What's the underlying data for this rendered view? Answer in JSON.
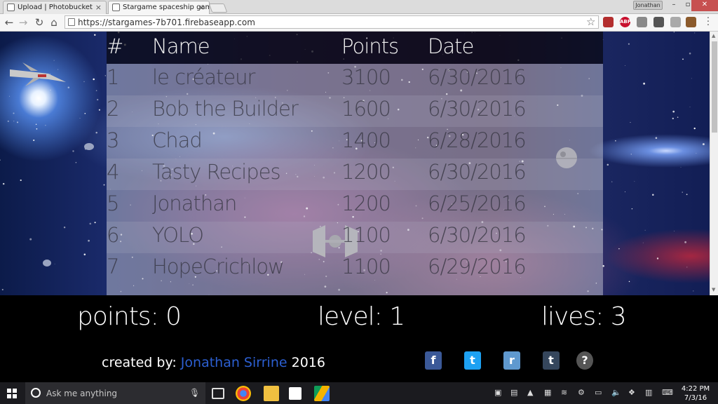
{
  "browser": {
    "tabs": [
      {
        "title": "Upload | Photobucket",
        "close": "×"
      },
      {
        "title": "Stargame spaceship game",
        "close": "×"
      }
    ],
    "profile": "Jonathan",
    "url": "https://stargames-7b701.firebaseapp.com",
    "extensions": [
      {
        "name": "abp-icon",
        "label": "ABP",
        "color": "#c8102e"
      },
      {
        "name": "bookmark-icon",
        "label": "",
        "color": "#b32e2e"
      }
    ]
  },
  "leaderboard": {
    "headers": {
      "rank": "#",
      "name": "Name",
      "points": "Points",
      "date": "Date"
    },
    "rows": [
      {
        "rank": "1",
        "name": "le créateur",
        "points": "3100",
        "date": "6/30/2016"
      },
      {
        "rank": "2",
        "name": "Bob the Builder",
        "points": "1600",
        "date": "6/30/2016"
      },
      {
        "rank": "3",
        "name": "Chad",
        "points": "1400",
        "date": "6/28/2016"
      },
      {
        "rank": "4",
        "name": "Tasty Recipes",
        "points": "1200",
        "date": "6/30/2016"
      },
      {
        "rank": "5",
        "name": "Jonathan",
        "points": "1200",
        "date": "6/25/2016"
      },
      {
        "rank": "6",
        "name": "YOLO",
        "points": "1100",
        "date": "6/30/2016"
      },
      {
        "rank": "7",
        "name": "HopeCrichlow",
        "points": "1100",
        "date": "6/29/2016"
      }
    ]
  },
  "hud": {
    "points_label": "points:",
    "points": "0",
    "level_label": "level:",
    "level": "1",
    "lives_label": "lives:",
    "lives": "3"
  },
  "footer": {
    "created_by": "created by:",
    "author": "Jonathan Sirrine",
    "year": "2016",
    "social": [
      {
        "name": "facebook-icon",
        "glyph": "f",
        "color": "#3b5998"
      },
      {
        "name": "twitter-icon",
        "glyph": "t",
        "color": "#1da1f2"
      },
      {
        "name": "reddit-icon",
        "glyph": "r",
        "color": "#5f99cf"
      },
      {
        "name": "tumblr-icon",
        "glyph": "t",
        "color": "#35465c"
      },
      {
        "name": "help-icon",
        "glyph": "?",
        "color": "#555555"
      }
    ]
  },
  "taskbar": {
    "search_placeholder": "Ask me anything",
    "time": "4:22 PM",
    "date": "7/3/16"
  }
}
